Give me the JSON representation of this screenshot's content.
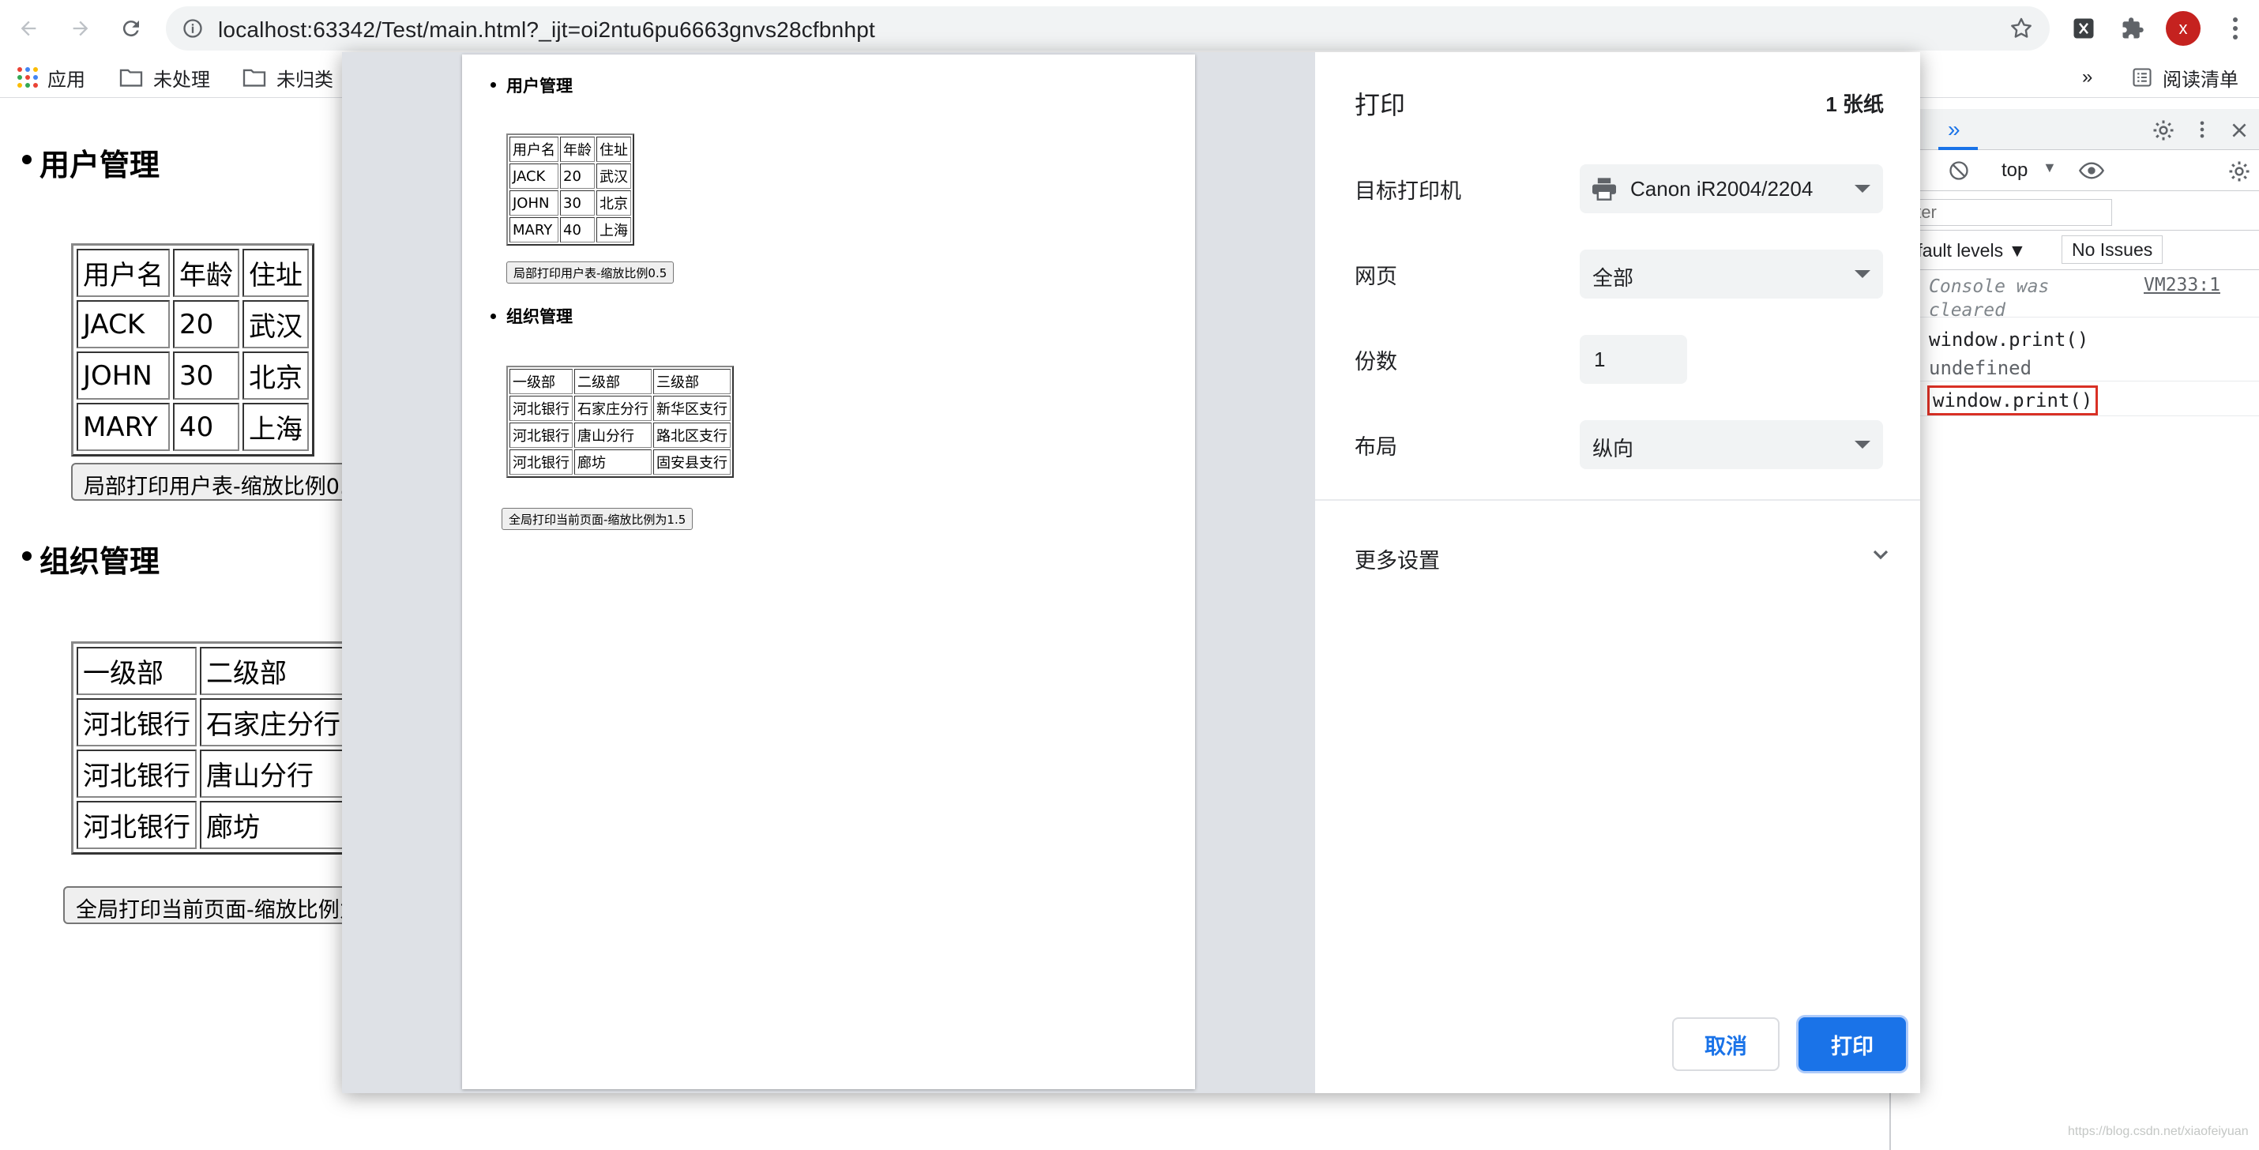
{
  "browser": {
    "url": "localhost:63342/Test/main.html?_ijt=oi2ntu6pu6663gnvs28cfbnhpt",
    "avatar_letter": "x",
    "bookmarks": [
      {
        "label": "应用",
        "icon": "apps-grid-icon"
      },
      {
        "label": "未处理",
        "icon": "folder-icon"
      },
      {
        "label": "未归类",
        "icon": "folder-icon"
      }
    ],
    "overflow_label": "»",
    "reading_list_label": "阅读清单"
  },
  "page": {
    "sections": [
      {
        "title": "用户管理",
        "table": [
          [
            "用户名",
            "年龄",
            "住址"
          ],
          [
            "JACK",
            "20",
            "武汉"
          ],
          [
            "JOHN",
            "30",
            "北京"
          ],
          [
            "MARY",
            "40",
            "上海"
          ]
        ],
        "button": "局部打印用户表-缩放比例0.5"
      },
      {
        "title": "组织管理",
        "table": [
          [
            "一级部",
            "二级部",
            "三级部"
          ],
          [
            "河北银行",
            "石家庄分行",
            "新华区支行"
          ],
          [
            "河北银行",
            "唐山分行",
            "路北区支行"
          ],
          [
            "河北银行",
            "廊坊",
            "固安县支行"
          ]
        ],
        "button": "全局打印当前页面-缩放比例为1.5"
      }
    ]
  },
  "devtools": {
    "context": "top",
    "filter_placeholder": "Filter",
    "levels_label": "Default levels ▼",
    "issues_label": "No Issues",
    "console": {
      "cleared_text": "Console was cleared",
      "cleared_source": "VM233:1",
      "lines": [
        "window.print()",
        "undefined",
        "window.print()"
      ]
    }
  },
  "print_dialog": {
    "title": "打印",
    "sheet_count": "1 张纸",
    "destination_label": "目标打印机",
    "destination_value": "Canon iR2004/2204",
    "pages_label": "网页",
    "pages_value": "全部",
    "copies_label": "份数",
    "copies_value": "1",
    "layout_label": "布局",
    "layout_value": "纵向",
    "more_settings_label": "更多设置",
    "cancel_label": "取消",
    "print_label": "打印"
  },
  "colors": {
    "accent": "#1a73e8",
    "highlight_box": "#d93025",
    "avatar": "#c5221f"
  },
  "watermark": "https://blog.csdn.net/xiaofeiyuan"
}
